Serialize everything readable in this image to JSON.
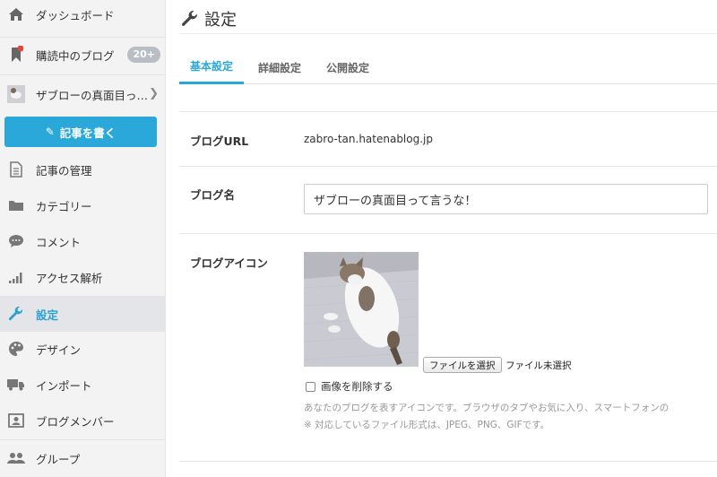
{
  "sidebar": {
    "dashboard": "ダッシュボード",
    "subscribed": "購読中のブログ",
    "subscribed_badge": "20+",
    "blog_name": "ザブローの真面目っ…",
    "write_button": "記事を書く",
    "items": [
      {
        "label": "記事の管理",
        "icon": "document-icon"
      },
      {
        "label": "カテゴリー",
        "icon": "folder-icon"
      },
      {
        "label": "コメント",
        "icon": "speech-bubble-icon"
      },
      {
        "label": "アクセス解析",
        "icon": "bar-chart-icon"
      },
      {
        "label": "設定",
        "icon": "wrench-icon"
      },
      {
        "label": "デザイン",
        "icon": "palette-icon"
      },
      {
        "label": "インポート",
        "icon": "truck-icon"
      },
      {
        "label": "ブログメンバー",
        "icon": "member-card-icon"
      },
      {
        "label": "グループ",
        "icon": "group-icon"
      }
    ]
  },
  "main": {
    "title": "設定",
    "tabs": [
      "基本設定",
      "詳細設定",
      "公開設定"
    ],
    "active_tab": "基本設定",
    "blog_url_label": "ブログURL",
    "blog_url_value": "zabro-tan.hatenablog.jp",
    "blog_name_label": "ブログ名",
    "blog_name_value": "ザブローの真面目って言うな！",
    "blog_icon_label": "ブログアイコン",
    "file_button": "ファイルを選択",
    "file_status": "ファイル未選択",
    "delete_image": "画像を削除する",
    "help_1": "あなたのブログを表すアイコンです。ブラウザのタブやお気に入り、スマートフォンの",
    "help_2": "※ 対応しているファイル形式は、JPEG、PNG、GIFです。"
  },
  "colors": {
    "accent": "#29a8d9",
    "sidebar_bg": "#f3f3f3",
    "active_bg": "#e3e5e8",
    "notification_dot": "#e8463c"
  }
}
